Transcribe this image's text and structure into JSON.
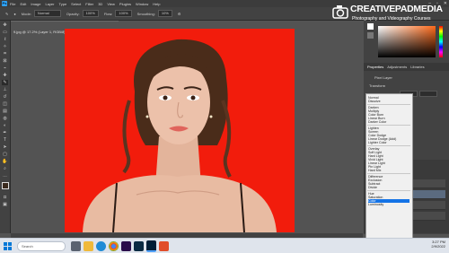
{
  "menu": {
    "app_icon": "Ps",
    "items": [
      "File",
      "Edit",
      "Image",
      "Layer",
      "Type",
      "Select",
      "Filter",
      "3D",
      "View",
      "Plugins",
      "Window",
      "Help"
    ]
  },
  "options": {
    "mode_label": "Mode:",
    "mode_value": "Normal",
    "opacity_label": "Opacity:",
    "opacity_value": "100%",
    "flow_label": "Flow:",
    "flow_value": "100%",
    "smoothing_label": "Smoothing:",
    "smoothing_value": "10%"
  },
  "document": {
    "tab_title": "9.jpg @ 17.2% (Layer 1, RGB/8) *"
  },
  "status": {
    "zoom": "17.19%",
    "doc_info": "3456 px x 5184 px (72 ppi)"
  },
  "panels": {
    "tabs": [
      "Properties",
      "Adjustments",
      "Libraries"
    ],
    "prop_section": "Pixel Layer",
    "transform_label": "Transform"
  },
  "watermark": {
    "brand": "CREATIVEPADMEDIA",
    "subtitle": "Photography and Videography Courses"
  },
  "blend_groups": [
    [
      "Normal",
      "Dissolve"
    ],
    [
      "Darken",
      "Multiply",
      "Color Burn",
      "Linear Burn",
      "Darker Color"
    ],
    [
      "Lighten",
      "Screen",
      "Color Dodge",
      "Linear Dodge (Add)",
      "Lighter Color"
    ],
    [
      "Overlay",
      "Soft Light",
      "Hard Light",
      "Vivid Light",
      "Linear Light",
      "Pin Light",
      "Hard Mix"
    ],
    [
      "Difference",
      "Exclusion",
      "Subtract",
      "Divide"
    ],
    [
      "Hue",
      "Saturation",
      "Color",
      "Luminosity"
    ]
  ],
  "blend_selected": "Color",
  "colors": {
    "canvas_bg": "#f21c0c",
    "accent": "#1473e6"
  },
  "taskbar": {
    "search_placeholder": "Search",
    "time": "3:27 PM",
    "date": "2/9/2022"
  }
}
